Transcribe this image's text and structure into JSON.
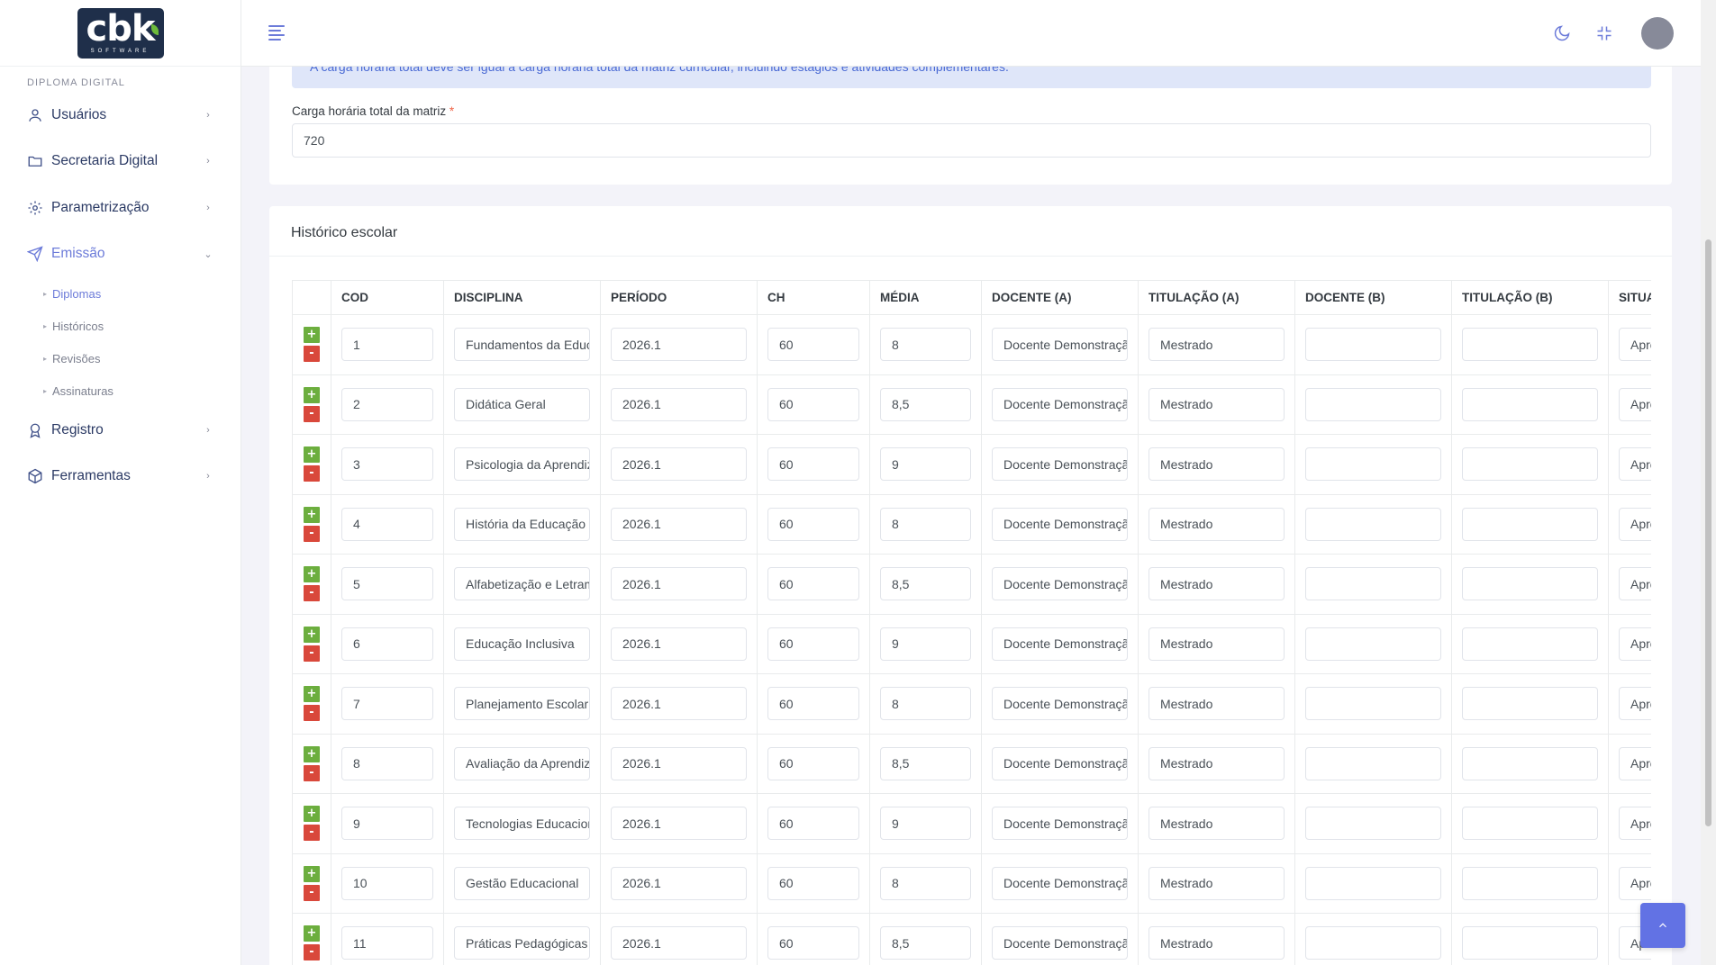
{
  "brand": {
    "logo_text": "cbk",
    "logo_sub": "SOFTWARE"
  },
  "sidebar": {
    "section_title": "DIPLOMA DIGITAL",
    "items": [
      {
        "label": "Usuários",
        "icon": "user-icon"
      },
      {
        "label": "Secretaria Digital",
        "icon": "folder-icon"
      },
      {
        "label": "Parametrização",
        "icon": "gear-icon"
      },
      {
        "label": "Emissão",
        "icon": "send-icon"
      },
      {
        "label": "Registro",
        "icon": "award-icon"
      },
      {
        "label": "Ferramentas",
        "icon": "box-icon"
      }
    ],
    "subitems": [
      "Diplomas",
      "Históricos",
      "Revisões",
      "Assinaturas"
    ]
  },
  "card1": {
    "alert_text": "A carga horária total deve ser igual à carga horária total da matriz curricular, incluindo estágios e atividades complementares.",
    "field_label": "Carga horária total da matriz",
    "required_mark": "*",
    "field_value": "720"
  },
  "card2": {
    "title": "Histórico escolar",
    "columns": [
      "COD",
      "DISCIPLINA",
      "PERÍODO",
      "CH",
      "MÉDIA",
      "DOCENTE (A)",
      "TITULAÇÃO (A)",
      "DOCENTE (B)",
      "TITULAÇÃO (B)",
      "SITUAÇÃO"
    ],
    "add_symbol": "+",
    "remove_symbol": "-",
    "rows": [
      [
        "1",
        "Fundamentos da Educação",
        "2026.1",
        "60",
        "8",
        "Docente Demonstração",
        "Mestrado",
        "",
        "",
        "Aprovado"
      ],
      [
        "2",
        "Didática Geral",
        "2026.1",
        "60",
        "8,5",
        "Docente Demonstração",
        "Mestrado",
        "",
        "",
        "Aprovado"
      ],
      [
        "3",
        "Psicologia da Aprendizagem",
        "2026.1",
        "60",
        "9",
        "Docente Demonstração",
        "Mestrado",
        "",
        "",
        "Aprovado"
      ],
      [
        "4",
        "História da Educação",
        "2026.1",
        "60",
        "8",
        "Docente Demonstração",
        "Mestrado",
        "",
        "",
        "Aprovado"
      ],
      [
        "5",
        "Alfabetização e Letramento",
        "2026.1",
        "60",
        "8,5",
        "Docente Demonstração",
        "Mestrado",
        "",
        "",
        "Aprovado"
      ],
      [
        "6",
        "Educação Inclusiva",
        "2026.1",
        "60",
        "9",
        "Docente Demonstração",
        "Mestrado",
        "",
        "",
        "Aprovado"
      ],
      [
        "7",
        "Planejamento Escolar",
        "2026.1",
        "60",
        "8",
        "Docente Demonstração",
        "Mestrado",
        "",
        "",
        "Aprovado"
      ],
      [
        "8",
        "Avaliação da Aprendizagem",
        "2026.1",
        "60",
        "8,5",
        "Docente Demonstração",
        "Mestrado",
        "",
        "",
        "Aprovado"
      ],
      [
        "9",
        "Tecnologias Educacionais",
        "2026.1",
        "60",
        "9",
        "Docente Demonstração",
        "Mestrado",
        "",
        "",
        "Aprovado"
      ],
      [
        "10",
        "Gestão Educacional",
        "2026.1",
        "60",
        "8",
        "Docente Demonstração",
        "Mestrado",
        "",
        "",
        "Aprovado"
      ],
      [
        "11",
        "Práticas Pedagógicas",
        "2026.1",
        "60",
        "8,5",
        "Docente Demonstração",
        "Mestrado",
        "",
        "",
        "Aprovado"
      ]
    ]
  },
  "colors": {
    "accent": "#6c7bd9",
    "sidebar_text": "#405189",
    "add": "#6cae3e",
    "remove": "#d9483b",
    "alert_bg": "#dfe6f9"
  }
}
